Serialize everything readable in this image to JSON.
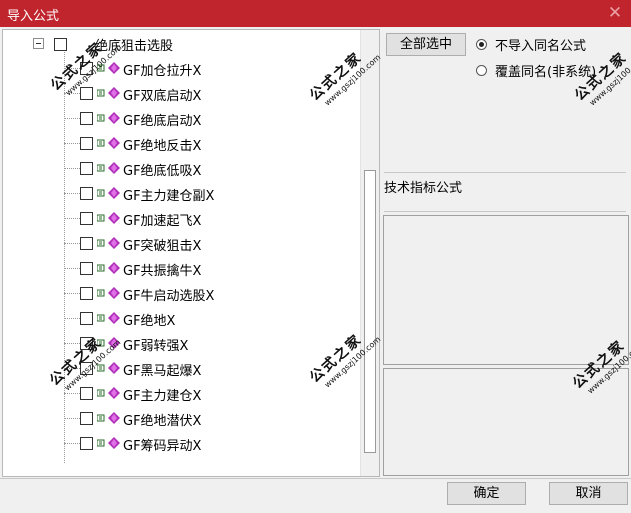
{
  "window": {
    "title": "导入公式",
    "close_glyph": "✕"
  },
  "tree": {
    "root": {
      "label": "绝底狙击选股",
      "expander": "collapse"
    },
    "items": [
      "GF加仓拉升X",
      "GF双底启动X",
      "GF绝底启动X",
      "GF绝地反击X",
      "GF绝底低吸X",
      "GF主力建仓副X",
      "GF加速起飞X",
      "GF突破狙击X",
      "GF共振擒牛X",
      "GF牛启动选股X",
      "GF绝地X",
      "GF弱转强X",
      "GF黑马起爆X",
      "GF主力建仓X",
      "GF绝地潜伏X",
      "GF筹码异动X"
    ],
    "icon_colors": {
      "chip": "#2a6b2a",
      "gem": "#b02fb8"
    }
  },
  "options": {
    "select_all_label": "全部选中",
    "radio_skip_label": "不导入同名公式",
    "radio_overwrite_label": "覆盖同名(非系统)",
    "selected": "skip"
  },
  "info": {
    "type_label": "技术指标公式"
  },
  "buttons": {
    "ok_label": "确定",
    "cancel_label": "取消"
  },
  "watermark": {
    "text": "公式之家",
    "url": "www.gszj100.com"
  },
  "colors": {
    "titlebar": "#c0252d"
  }
}
